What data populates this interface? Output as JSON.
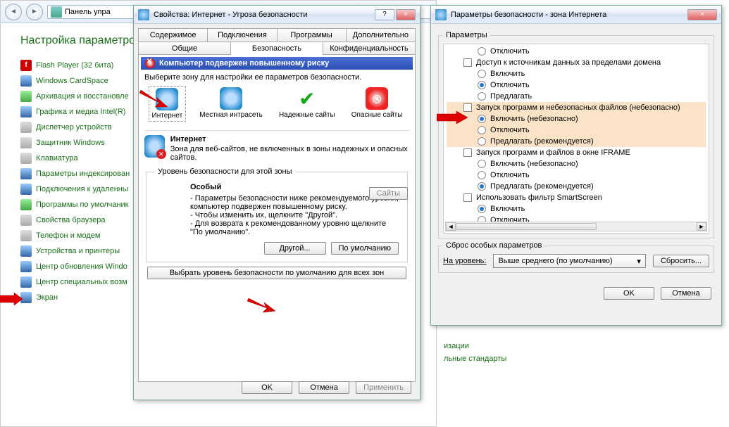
{
  "cp": {
    "addr": "Панель упра",
    "heading": "Настройка параметров",
    "items": [
      {
        "label": "Flash Player (32 бита)",
        "icon": "flash"
      },
      {
        "label": "Windows CardSpace",
        "icon": "blue"
      },
      {
        "label": "Архивация и восстановле",
        "icon": "green"
      },
      {
        "label": "Графика и медиа Intel(R)",
        "icon": "blue"
      },
      {
        "label": "Диспетчер устройств",
        "icon": "grey"
      },
      {
        "label": "Защитник Windows",
        "icon": "grey"
      },
      {
        "label": "Клавиатура",
        "icon": "grey"
      },
      {
        "label": "Параметры индексирован",
        "icon": "blue"
      },
      {
        "label": "Подключения к удаленны",
        "icon": "blue"
      },
      {
        "label": "Программы по умолчаник",
        "icon": "green"
      },
      {
        "label": "Свойства браузера",
        "icon": "grey"
      },
      {
        "label": "Телефон и модем",
        "icon": "grey"
      },
      {
        "label": "Устройства и принтеры",
        "icon": "blue"
      },
      {
        "label": "Центр обновления Windo",
        "icon": "blue"
      },
      {
        "label": "Центр специальных возм",
        "icon": "blue"
      },
      {
        "label": "Экран",
        "icon": "blue"
      }
    ],
    "footer1": "изации",
    "footer2": "льные стандарты"
  },
  "d1": {
    "title": "Свойства: Интернет - Угроза безопасности",
    "help_btn": "?",
    "close_btn": "×",
    "tabs_row1": [
      "Содержимое",
      "Подключения",
      "Программы",
      "Дополнительно"
    ],
    "tabs_row2": [
      "Общие",
      "Безопасность",
      "Конфиденциальность"
    ],
    "active_tab_index": 1,
    "warning": "Компьютер подвержен повышенному риску",
    "zone_instr": "Выберите зону для настройки ее параметров безопасности.",
    "zones": [
      "Интернет",
      "Местная интрасеть",
      "Надежные сайты",
      "Опасные сайты"
    ],
    "zone_title": "Интернет",
    "zone_text": "Зона для веб-сайтов, не включенных в зоны надежных и опасных сайтов.",
    "sites_btn": "Сайты",
    "level_legend": "Уровень безопасности для этой зоны",
    "level_name": "Особый",
    "level_l1": "- Параметры безопасности ниже рекомендуемого уровня, компьютер подвержен повышенному риску.",
    "level_l2": "- Чтобы изменить их, щелкните \"Другой\".",
    "level_l3": "- Для возврата к рекомендованному уровню щелкните \"По умолчанию\".",
    "other_btn": "Другой...",
    "default_btn": "По умолчанию",
    "reset_all_btn": "Выбрать уровень безопасности по умолчанию для всех зон",
    "ok": "OK",
    "cancel": "Отмена",
    "apply": "Применить"
  },
  "d2": {
    "title": "Параметры безопасности - зона Интернета",
    "close_btn": "×",
    "params_legend": "Параметры",
    "rows": [
      {
        "lvl": 2,
        "kind": "radio",
        "on": false,
        "hl": false,
        "text": "Отключить"
      },
      {
        "lvl": 1,
        "kind": "chk",
        "on": false,
        "hl": false,
        "text": "Доступ к источникам данных за пределами домена"
      },
      {
        "lvl": 2,
        "kind": "radio",
        "on": false,
        "hl": false,
        "text": "Включить"
      },
      {
        "lvl": 2,
        "kind": "radio",
        "on": true,
        "hl": false,
        "text": "Отключить"
      },
      {
        "lvl": 2,
        "kind": "radio",
        "on": false,
        "hl": false,
        "text": "Предлагать"
      },
      {
        "lvl": 1,
        "kind": "chk",
        "on": false,
        "hl": true,
        "text": "Запуск программ и небезопасных файлов (небезопасно)"
      },
      {
        "lvl": 2,
        "kind": "radio",
        "on": true,
        "hl": true,
        "text": "Включить (небезопасно)"
      },
      {
        "lvl": 2,
        "kind": "radio",
        "on": false,
        "hl": true,
        "text": "Отключить"
      },
      {
        "lvl": 2,
        "kind": "radio",
        "on": false,
        "hl": true,
        "text": "Предлагать (рекомендуется)"
      },
      {
        "lvl": 1,
        "kind": "chk",
        "on": false,
        "hl": false,
        "text": "Запуск программ и файлов в окне IFRAME"
      },
      {
        "lvl": 2,
        "kind": "radio",
        "on": false,
        "hl": false,
        "text": "Включить (небезопасно)"
      },
      {
        "lvl": 2,
        "kind": "radio",
        "on": false,
        "hl": false,
        "text": "Отключить"
      },
      {
        "lvl": 2,
        "kind": "radio",
        "on": true,
        "hl": false,
        "text": "Предлагать (рекомендуется)"
      },
      {
        "lvl": 1,
        "kind": "chk",
        "on": false,
        "hl": false,
        "text": "Использовать фильтр SmartScreen"
      },
      {
        "lvl": 2,
        "kind": "radio",
        "on": true,
        "hl": false,
        "text": "Включить"
      },
      {
        "lvl": 2,
        "kind": "radio",
        "on": false,
        "hl": false,
        "text": "Отключить"
      }
    ],
    "reset_legend": "Сброс особых параметров",
    "reset_lbl": "На уровень:",
    "reset_value": "Выше среднего (по умолчанию)",
    "reset_btn": "Сбросить...",
    "ok": "OK",
    "cancel": "Отмена"
  }
}
